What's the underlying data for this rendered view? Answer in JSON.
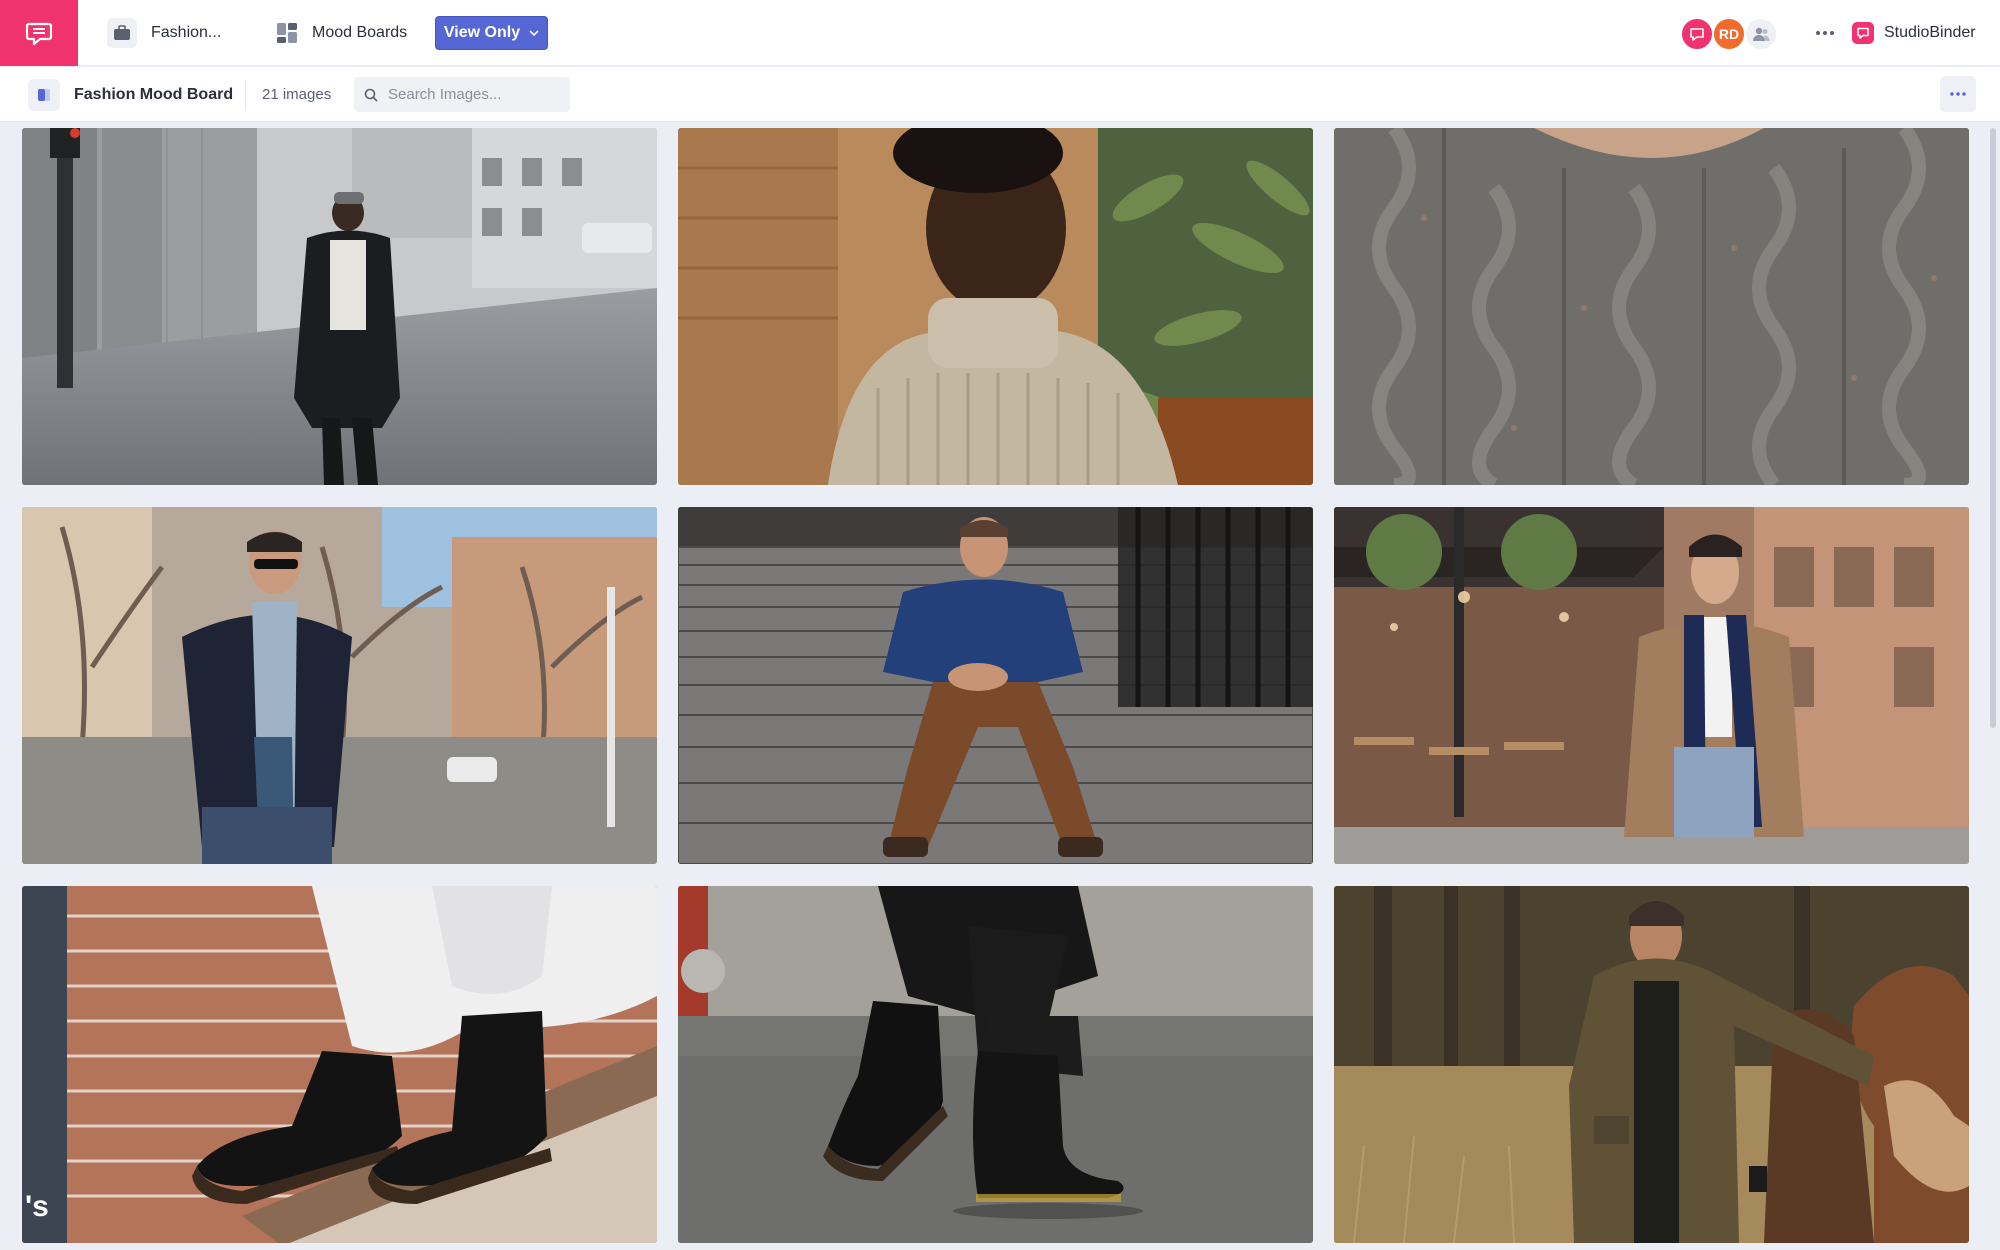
{
  "topbar": {
    "project_label": "Fashion...",
    "module_label": "Mood Boards",
    "view_button_label": "View Only",
    "avatars": [
      {
        "initials": "",
        "color": "#f0336f",
        "icon": "chat-icon"
      },
      {
        "initials": "RD",
        "color": "#f26b2a"
      },
      {
        "initials": "",
        "color": "#eef0f5",
        "icon": "team-icon"
      }
    ],
    "brand_name": "StudioBinder",
    "accent_color": "#f0336f",
    "button_color": "#5567d4"
  },
  "subbar": {
    "board_title": "Fashion Mood Board",
    "image_count": "21 images",
    "search_placeholder": "Search Images..."
  },
  "gallery": {
    "images": [
      {
        "subject": "man-in-black-coat-walking-street"
      },
      {
        "subject": "man-in-beige-turtleneck-sweater"
      },
      {
        "subject": "grey-cable-knit-sweater-closeup"
      },
      {
        "subject": "man-in-navy-jacket-and-scarf"
      },
      {
        "subject": "man-sitting-on-stone-steps"
      },
      {
        "subject": "man-in-camel-coat-navy-scarf"
      },
      {
        "subject": "black-boots-on-brick-steps",
        "overlay_text": "'s"
      },
      {
        "subject": "black-lace-up-boots-wet-street"
      },
      {
        "subject": "man-in-olive-jacket-with-horse"
      }
    ]
  }
}
